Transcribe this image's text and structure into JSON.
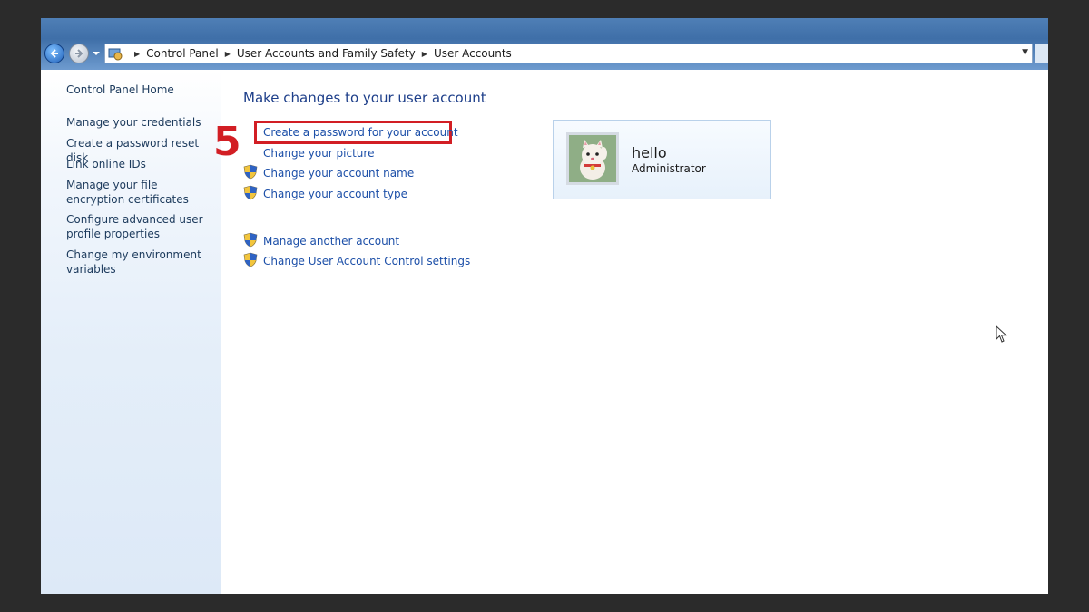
{
  "window": {
    "breadcrumbs": [
      "Control Panel",
      "User Accounts and Family Safety",
      "User Accounts"
    ]
  },
  "sidebar": {
    "items": [
      {
        "label": "Control Panel Home"
      },
      {
        "label": "Manage your credentials"
      },
      {
        "label": "Create a password reset disk"
      },
      {
        "label": "Link online IDs"
      },
      {
        "label": "Manage your file encryption certificates"
      },
      {
        "label": "Configure advanced user profile properties"
      },
      {
        "label": "Change my environment variables"
      }
    ]
  },
  "main": {
    "title": "Make changes to your user account",
    "tasks": [
      {
        "label": "Create a password for your account",
        "icon": "none"
      },
      {
        "label": "Change your picture",
        "icon": "none"
      },
      {
        "label": "Change your account name",
        "icon": "uac-shield-icon"
      },
      {
        "label": "Change your account type",
        "icon": "uac-shield-icon"
      }
    ],
    "other_tasks": [
      {
        "label": "Manage another account",
        "icon": "uac-shield-icon"
      },
      {
        "label": "Change User Account Control settings",
        "icon": "uac-shield-icon"
      }
    ],
    "annotation": {
      "step_number": "5",
      "color": "#d21e24"
    },
    "account": {
      "name": "hello",
      "type": "Administrator"
    }
  },
  "colors": {
    "link": "#1c4fa8",
    "title": "#1e3f8a",
    "sidebar_text": "#1c3a5c",
    "highlight": "#d21e24"
  }
}
